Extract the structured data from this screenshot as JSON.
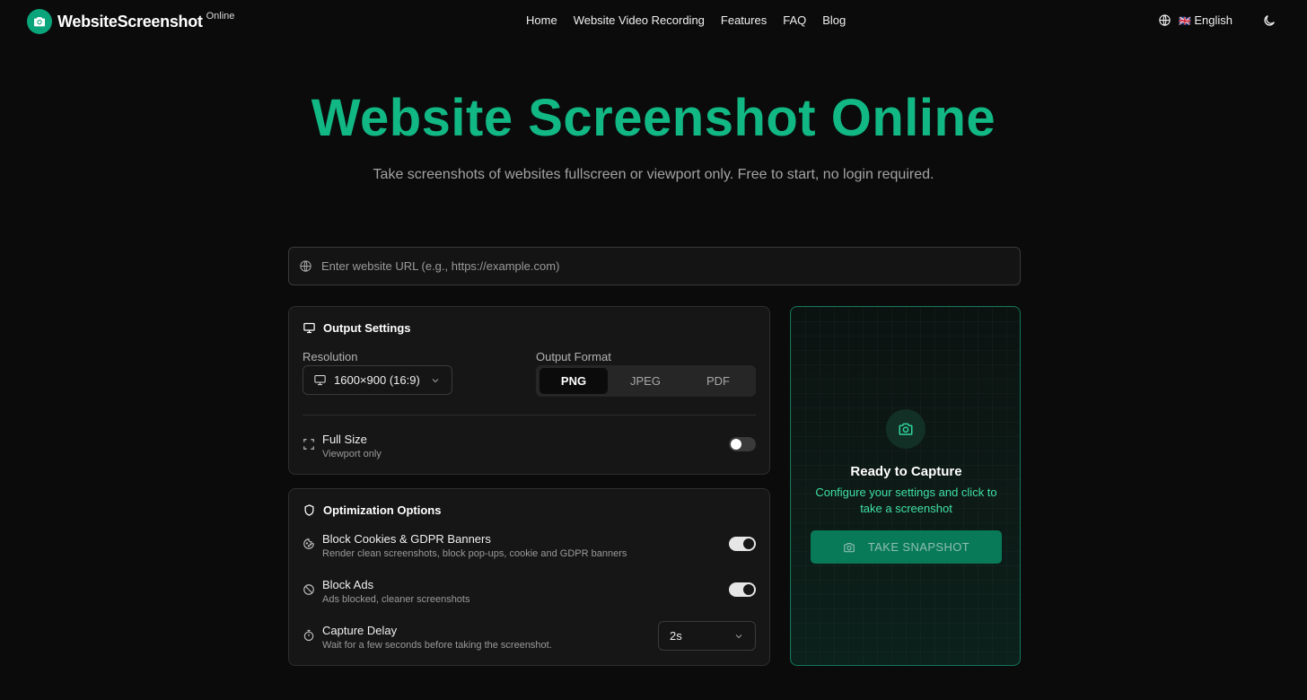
{
  "header": {
    "logo_name": "WebsiteScreenshot",
    "logo_suffix": "Online",
    "nav": [
      "Home",
      "Website Video Recording",
      "Features",
      "FAQ",
      "Blog"
    ],
    "language_flag": "🇬🇧",
    "language": "English"
  },
  "hero": {
    "title": "Website Screenshot Online",
    "subtitle": "Take screenshots of websites fullscreen or viewport only. Free to start, no login required."
  },
  "url_input": {
    "placeholder": "Enter website URL (e.g., https://example.com)",
    "value": ""
  },
  "output_settings": {
    "title": "Output Settings",
    "resolution_label": "Resolution",
    "resolution_value": "1600×900 (16:9)",
    "format_label": "Output Format",
    "formats": [
      "PNG",
      "JPEG",
      "PDF"
    ],
    "selected_format": "PNG",
    "full_size_title": "Full Size",
    "full_size_desc": "Viewport only",
    "full_size_enabled": false
  },
  "optimization": {
    "title": "Optimization Options",
    "block_cookies_title": "Block Cookies & GDPR Banners",
    "block_cookies_desc": "Render clean screenshots, block pop-ups, cookie and GDPR banners",
    "block_cookies_enabled": true,
    "block_ads_title": "Block Ads",
    "block_ads_desc": "Ads blocked, cleaner screenshots",
    "block_ads_enabled": true,
    "capture_delay_title": "Capture Delay",
    "capture_delay_desc": "Wait for a few seconds before taking the screenshot.",
    "capture_delay_value": "2s"
  },
  "capture": {
    "title": "Ready to Capture",
    "subtitle": "Configure your settings and click to take a screenshot",
    "button_label": "TAKE SNAPSHOT"
  },
  "colors": {
    "accent": "#12b884",
    "accent_dark": "#087a58",
    "background": "#0b0b0b",
    "card": "#161616"
  },
  "icons": {
    "logo": "camera-icon",
    "language": "globe-icon",
    "theme": "moon-icon",
    "url": "globe-icon",
    "output": "monitor-icon",
    "resolution": "monitor-icon",
    "resolution_dropdown": "chevron-down-icon",
    "full_size": "expand-icon",
    "optimization": "shield-icon",
    "cookies": "cookie-icon",
    "ads": "ban-icon",
    "delay": "timer-icon",
    "delay_dropdown": "chevron-down-icon",
    "capture": "camera-icon"
  }
}
